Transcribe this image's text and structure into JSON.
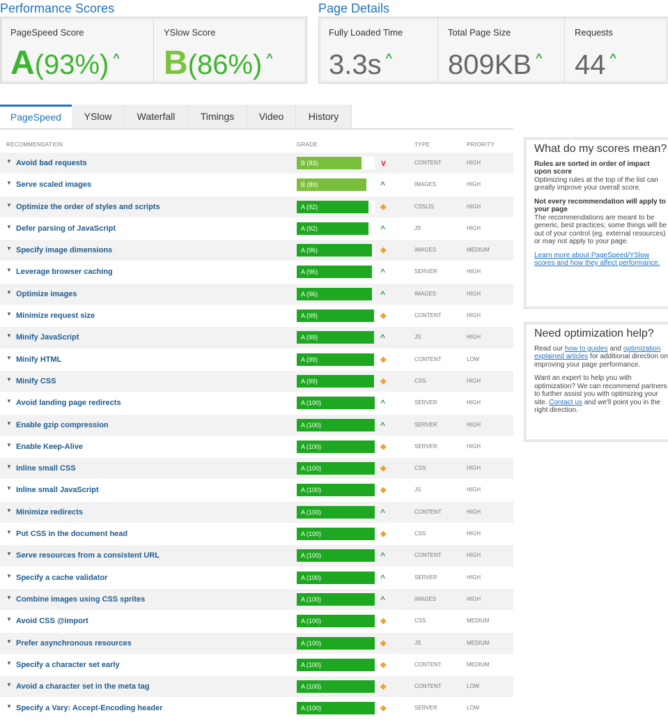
{
  "performance": {
    "title": "Performance Scores",
    "pagespeed": {
      "label": "PageSpeed Score",
      "grade": "A",
      "percent": "(93%)"
    },
    "yslow": {
      "label": "YSlow Score",
      "grade": "B",
      "percent": "(86%)"
    }
  },
  "details": {
    "title": "Page Details",
    "load_time": {
      "label": "Fully Loaded Time",
      "value": "3.3s"
    },
    "page_size": {
      "label": "Total Page Size",
      "value": "809KB"
    },
    "requests": {
      "label": "Requests",
      "value": "44"
    }
  },
  "icons": {
    "up": "▲-caret-icon",
    "down": "chevron-down-icon",
    "neutral": "diamond-icon",
    "row_toggle": "triangle-down-icon"
  },
  "colors": {
    "accent": "#1e73be",
    "grade_a": "#1ea821",
    "grade_b": "#79bf3b",
    "trend_up": "#2a9e38",
    "trend_down": "#d9363e",
    "trend_neutral": "#f0a030"
  },
  "tabs": [
    "PageSpeed",
    "YSlow",
    "Waterfall",
    "Timings",
    "Video",
    "History"
  ],
  "active_tab": "PageSpeed",
  "columns": {
    "recommendation": "RECOMMENDATION",
    "grade": "GRADE",
    "type": "TYPE",
    "priority": "PRIORITY"
  },
  "rows": [
    {
      "name": "Avoid bad requests",
      "grade": "B (83)",
      "score": 83,
      "trend": "down",
      "type": "CONTENT",
      "priority": "HIGH"
    },
    {
      "name": "Serve scaled images",
      "grade": "B (89)",
      "score": 89,
      "trend": "up",
      "type": "IMAGES",
      "priority": "HIGH"
    },
    {
      "name": "Optimize the order of styles and scripts",
      "grade": "A (92)",
      "score": 92,
      "trend": "neutral",
      "type": "CSS/JS",
      "priority": "HIGH"
    },
    {
      "name": "Defer parsing of JavaScript",
      "grade": "A (92)",
      "score": 92,
      "trend": "up",
      "type": "JS",
      "priority": "HIGH"
    },
    {
      "name": "Specify image dimensions",
      "grade": "A (96)",
      "score": 96,
      "trend": "neutral",
      "type": "IMAGES",
      "priority": "MEDIUM"
    },
    {
      "name": "Leverage browser caching",
      "grade": "A (96)",
      "score": 96,
      "trend": "up",
      "type": "SERVER",
      "priority": "HIGH"
    },
    {
      "name": "Optimize images",
      "grade": "A (96)",
      "score": 96,
      "trend": "up",
      "type": "IMAGES",
      "priority": "HIGH"
    },
    {
      "name": "Minimize request size",
      "grade": "A (99)",
      "score": 99,
      "trend": "neutral",
      "type": "CONTENT",
      "priority": "HIGH"
    },
    {
      "name": "Minify JavaScript",
      "grade": "A (99)",
      "score": 99,
      "trend": "up",
      "type": "JS",
      "priority": "HIGH"
    },
    {
      "name": "Minify HTML",
      "grade": "A (99)",
      "score": 99,
      "trend": "neutral",
      "type": "CONTENT",
      "priority": "LOW"
    },
    {
      "name": "Minify CSS",
      "grade": "A (99)",
      "score": 99,
      "trend": "neutral",
      "type": "CSS",
      "priority": "HIGH"
    },
    {
      "name": "Avoid landing page redirects",
      "grade": "A (100)",
      "score": 100,
      "trend": "up",
      "type": "SERVER",
      "priority": "HIGH"
    },
    {
      "name": "Enable gzip compression",
      "grade": "A (100)",
      "score": 100,
      "trend": "up",
      "type": "SERVER",
      "priority": "HIGH"
    },
    {
      "name": "Enable Keep-Alive",
      "grade": "A (100)",
      "score": 100,
      "trend": "neutral",
      "type": "SERVER",
      "priority": "HIGH"
    },
    {
      "name": "Inline small CSS",
      "grade": "A (100)",
      "score": 100,
      "trend": "neutral",
      "type": "CSS",
      "priority": "HIGH"
    },
    {
      "name": "Inline small JavaScript",
      "grade": "A (100)",
      "score": 100,
      "trend": "neutral",
      "type": "JS",
      "priority": "HIGH"
    },
    {
      "name": "Minimize redirects",
      "grade": "A (100)",
      "score": 100,
      "trend": "up",
      "type": "CONTENT",
      "priority": "HIGH"
    },
    {
      "name": "Put CSS in the document head",
      "grade": "A (100)",
      "score": 100,
      "trend": "neutral",
      "type": "CSS",
      "priority": "HIGH"
    },
    {
      "name": "Serve resources from a consistent URL",
      "grade": "A (100)",
      "score": 100,
      "trend": "up",
      "type": "CONTENT",
      "priority": "HIGH"
    },
    {
      "name": "Specify a cache validator",
      "grade": "A (100)",
      "score": 100,
      "trend": "up",
      "type": "SERVER",
      "priority": "HIGH"
    },
    {
      "name": "Combine images using CSS sprites",
      "grade": "A (100)",
      "score": 100,
      "trend": "up",
      "type": "IMAGES",
      "priority": "HIGH"
    },
    {
      "name": "Avoid CSS @import",
      "grade": "A (100)",
      "score": 100,
      "trend": "neutral",
      "type": "CSS",
      "priority": "MEDIUM"
    },
    {
      "name": "Prefer asynchronous resources",
      "grade": "A (100)",
      "score": 100,
      "trend": "neutral",
      "type": "JS",
      "priority": "MEDIUM"
    },
    {
      "name": "Specify a character set early",
      "grade": "A (100)",
      "score": 100,
      "trend": "neutral",
      "type": "CONTENT",
      "priority": "MEDIUM"
    },
    {
      "name": "Avoid a character set in the meta tag",
      "grade": "A (100)",
      "score": 100,
      "trend": "neutral",
      "type": "CONTENT",
      "priority": "LOW"
    },
    {
      "name": "Specify a Vary: Accept-Encoding header",
      "grade": "A (100)",
      "score": 100,
      "trend": "neutral",
      "type": "SERVER",
      "priority": "LOW"
    }
  ],
  "sidebar": {
    "scores_box": {
      "title": "What do my scores mean?",
      "h1": "Rules are sorted in order of impact upon score",
      "p1": "Optimizing rules at the top of the list can greatly improve your overall score.",
      "h2": "Not every recommendation will apply to your page",
      "p2": "The recommendations are meant to be generic, best practices; some things will be out of your control (eg. external resources) or may not apply to your page.",
      "link": "Learn more about PageSpeed/YSlow scores and how they affect performance."
    },
    "help_box": {
      "title": "Need optimization help?",
      "p1_a": "Read our ",
      "p1_link1": "how to guides",
      "p1_b": " and ",
      "p1_link2": "optimization explained articles",
      "p1_c": " for additional direction on improving your page performance.",
      "p2_a": "Want an expert to help you with optimization? We can recommend partners to further assist you with optimizing your site. ",
      "p2_link": "Contact us",
      "p2_b": " and we'll point you in the right direction."
    }
  }
}
